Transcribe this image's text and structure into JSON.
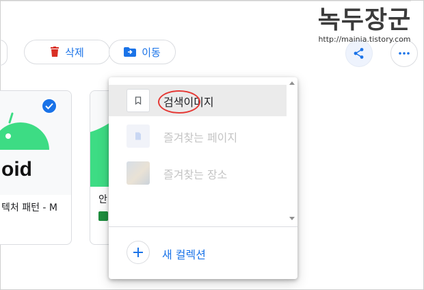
{
  "toolbar": {
    "delete_label": "삭제",
    "move_label": "이동",
    "delete_icon": "trash-icon",
    "move_icon": "folder-move-icon",
    "share_icon": "share-icon",
    "more_icon": "more-horizontal-icon"
  },
  "watermark": {
    "title": "녹두장군",
    "url": "http://mainia.tistory.com"
  },
  "cards": [
    {
      "image_text": "oid",
      "title": "텍처 패턴 - M",
      "selected": true
    },
    {
      "title": "안"
    }
  ],
  "menu": {
    "items": [
      {
        "label": "검색이미지",
        "icon": "bookmark-icon",
        "state": "hovered"
      },
      {
        "label": "즐겨찾는 페이지",
        "icon": "document-icon",
        "state": "disabled"
      },
      {
        "label": "즐겨찾는 장소",
        "icon": "photo-thumbnail",
        "state": "disabled"
      }
    ],
    "new_collection_label": "새 컬렉션"
  },
  "colors": {
    "accent": "#1a73e8",
    "delete_red": "#d93025",
    "android_green": "#3ddc84",
    "disabled_text": "#c4c4c4",
    "annotation_red": "#e53935"
  }
}
